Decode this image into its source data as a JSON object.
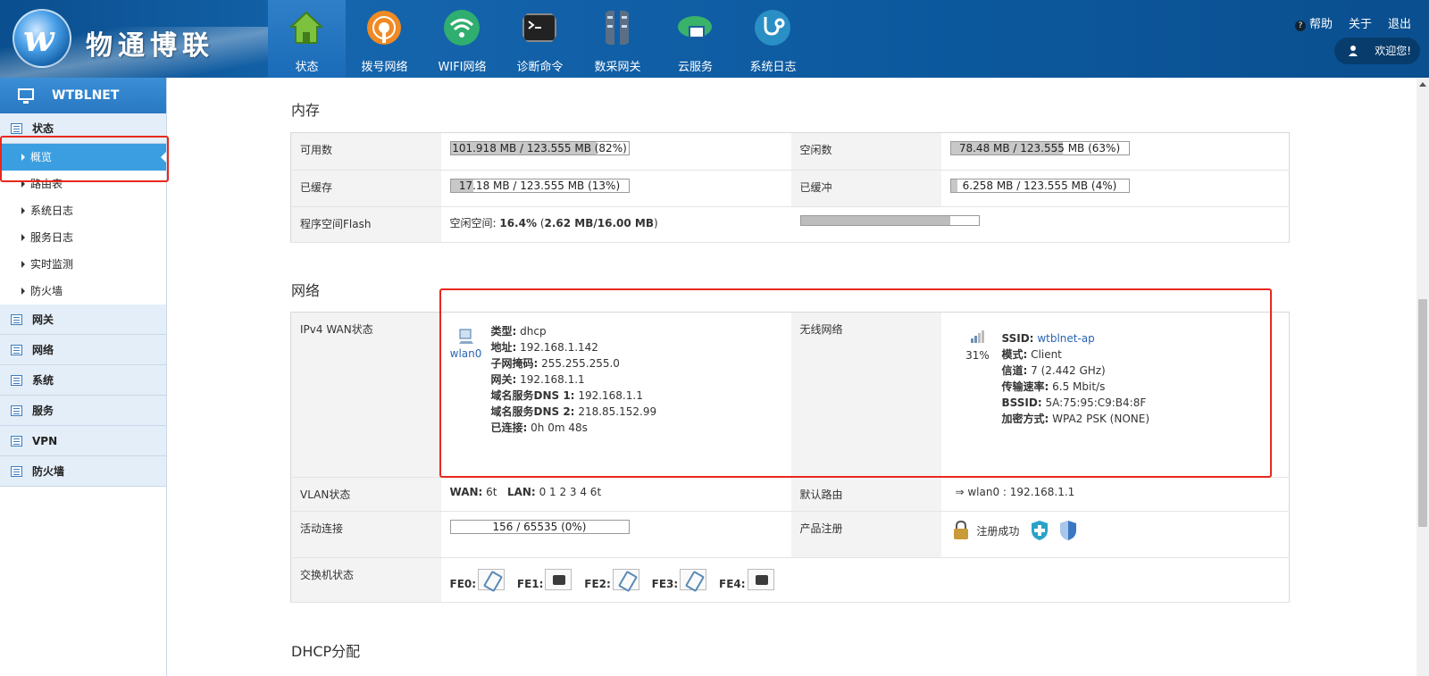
{
  "header": {
    "brand": "物通博联",
    "tabs": [
      {
        "label": "状态",
        "icon": "home-icon"
      },
      {
        "label": "拨号网络",
        "icon": "dialup-icon"
      },
      {
        "label": "WIFI网络",
        "icon": "wifi-icon"
      },
      {
        "label": "诊断命令",
        "icon": "terminal-icon"
      },
      {
        "label": "数采网关",
        "icon": "gateway-icon"
      },
      {
        "label": "云服务",
        "icon": "cloud-icon"
      },
      {
        "label": "系统日志",
        "icon": "stethoscope-icon"
      }
    ],
    "help": "帮助",
    "about": "关于",
    "logout": "退出",
    "welcome": "欢迎您!"
  },
  "sidebar": {
    "title": "WTBLNET",
    "status_group": "状态",
    "status_items": [
      "概览",
      "路由表",
      "系统日志",
      "服务日志",
      "实时监测",
      "防火墙"
    ],
    "groups": [
      "网关",
      "网络",
      "系统",
      "服务",
      "VPN",
      "防火墙"
    ]
  },
  "memory": {
    "title": "内存",
    "available_label": "可用数",
    "available_text": "101.918 MB / 123.555 MB (82%)",
    "available_pct": 82,
    "free_label": "空闲数",
    "free_text": "78.48 MB / 123.555 MB (63%)",
    "free_pct": 63,
    "cached_label": "已缓存",
    "cached_text": "17.18 MB / 123.555 MB (13%)",
    "cached_pct": 13,
    "buffered_label": "已缓冲",
    "buffered_text": "6.258 MB / 123.555 MB (4%)",
    "buffered_pct": 4,
    "flash_label": "程序空间Flash",
    "flash_prefix": "空闲空间: ",
    "flash_pct_text": "16.4%",
    "flash_paren_open": " (",
    "flash_size": "2.62 MB/16.00 MB",
    "flash_paren_close": ")",
    "flash_used_pct": 84
  },
  "network": {
    "title": "网络",
    "wan_label": "IPv4 WAN状态",
    "wan_iface": "wlan0",
    "wan_type_k": "类型:",
    "wan_type_v": "dhcp",
    "wan_addr_k": "地址:",
    "wan_addr_v": "192.168.1.142",
    "wan_mask_k": "子网掩码:",
    "wan_mask_v": "255.255.255.0",
    "wan_gw_k": "网关:",
    "wan_gw_v": "192.168.1.1",
    "wan_dns1_k": "域名服务DNS 1:",
    "wan_dns1_v": "192.168.1.1",
    "wan_dns2_k": "域名服务DNS 2:",
    "wan_dns2_v": "218.85.152.99",
    "wan_conn_k": "已连接:",
    "wan_conn_v": "0h 0m 48s",
    "wifi_label": "无线网络",
    "wifi_signal": "31%",
    "wifi_ssid_k": "SSID:",
    "wifi_ssid_v": "wtblnet-ap",
    "wifi_mode_k": "模式:",
    "wifi_mode_v": "Client",
    "wifi_chan_k": "信道:",
    "wifi_chan_v": "7 (2.442 GHz)",
    "wifi_rate_k": "传输速率:",
    "wifi_rate_v": "6.5 Mbit/s",
    "wifi_bssid_k": "BSSID:",
    "wifi_bssid_v": "5A:75:95:C9:B4:8F",
    "wifi_enc_k": "加密方式:",
    "wifi_enc_v": "WPA2 PSK (NONE)",
    "vlan_label": "VLAN状态",
    "vlan_wan_k": "WAN:",
    "vlan_wan_v": "6t",
    "vlan_lan_k": "LAN:",
    "vlan_lan_v": "0 1 2 3 4 6t",
    "route_label": "默认路由",
    "route_v": "⇒ wlan0 : 192.168.1.1",
    "conn_label": "活动连接",
    "conn_text": "156 / 65535 (0%)",
    "conn_pct": 0,
    "reg_label": "产品注册",
    "reg_v": "注册成功",
    "switch_label": "交换机状态",
    "ports": [
      {
        "name": "FE0:",
        "state": "up"
      },
      {
        "name": "FE1:",
        "state": "down"
      },
      {
        "name": "FE2:",
        "state": "up"
      },
      {
        "name": "FE3:",
        "state": "up"
      },
      {
        "name": "FE4:",
        "state": "down"
      }
    ]
  },
  "dhcp": {
    "title": "DHCP分配"
  }
}
